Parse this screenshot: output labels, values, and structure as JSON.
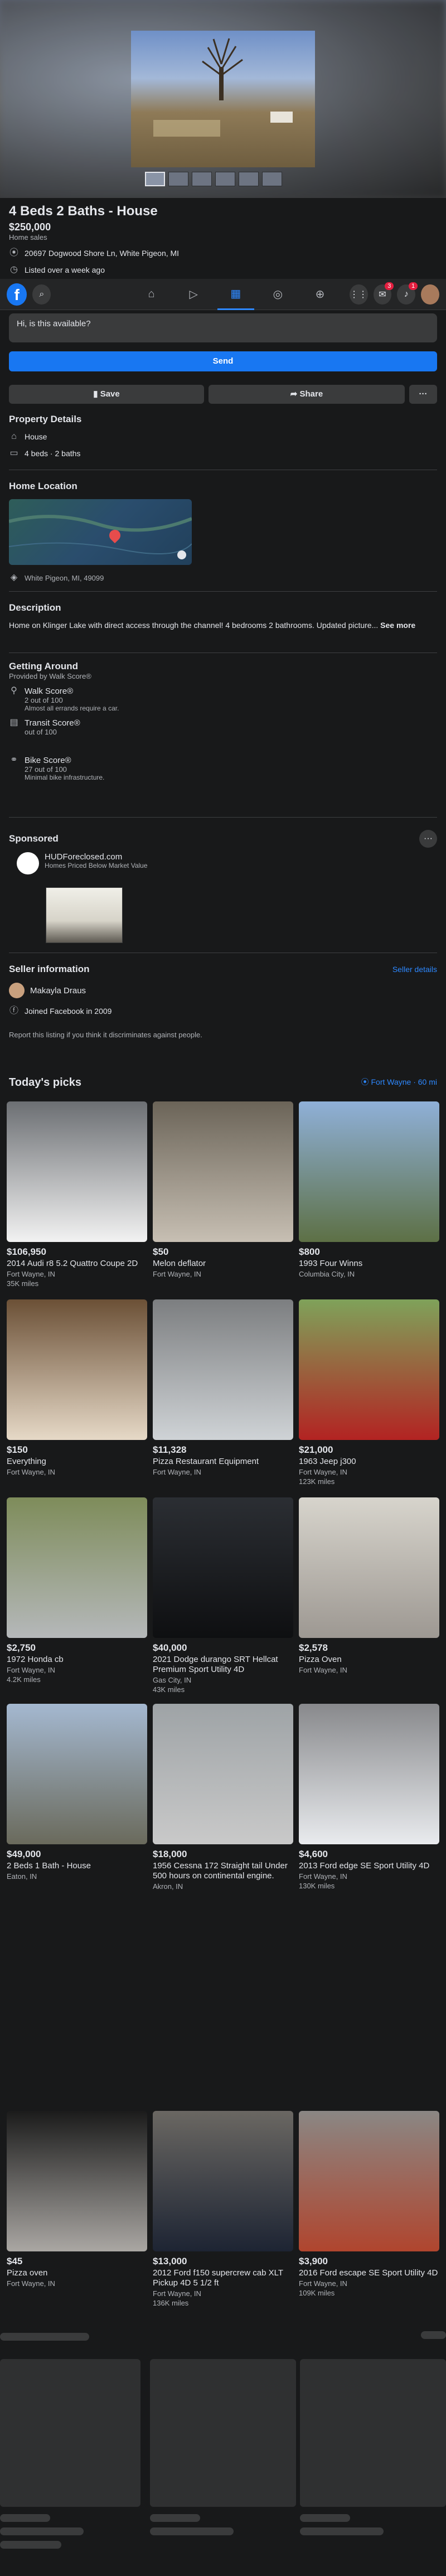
{
  "listing": {
    "title": "4 Beds 2 Baths - House",
    "price": "$250,000",
    "category": "Home sales",
    "address": "20697 Dogwood Shore Ln, White Pigeon, MI",
    "listed": "Listed over a week ago"
  },
  "message": {
    "text": "Hi, is this available?",
    "send_label": "Send"
  },
  "actions": {
    "save": "Save",
    "share": "Share",
    "more": "···"
  },
  "details": {
    "heading": "Property Details",
    "type": "House",
    "rooms": "4 beds · 2 baths"
  },
  "location": {
    "heading": "Home Location",
    "place": "White Pigeon, MI, 49099"
  },
  "description": {
    "heading": "Description",
    "text": "Home on Klinger Lake with direct access through the channel! 4 bedrooms 2 bathrooms. Updated picture...",
    "see_more": "See more"
  },
  "getting_around": {
    "heading": "Getting Around",
    "provider": "Provided by Walk Score®",
    "walk": {
      "label": "Walk Score®",
      "score": "2 out of 100",
      "desc": "Almost all errands require a car."
    },
    "transit": {
      "label": "Transit Score®",
      "score": "out of 100"
    },
    "bike": {
      "label": "Bike Score®",
      "score": "27 out of 100",
      "desc": "Minimal bike infrastructure."
    }
  },
  "sponsored": {
    "heading": "Sponsored",
    "name": "HUDForeclosed.com",
    "tagline": "Homes Priced Below Market Value"
  },
  "seller": {
    "heading": "Seller information",
    "details_link": "Seller details",
    "name": "Makayla Draus",
    "joined": "Joined Facebook in 2009",
    "report": "Report this listing if you think it discriminates against people."
  },
  "picks": {
    "heading": "Today's picks",
    "location": "Fort Wayne · 60 mi",
    "items": [
      {
        "price": "$106,950",
        "title": "2014 Audi r8 5.2 Quattro Coupe 2D",
        "loc": "Fort Wayne, IN",
        "extra": "35K miles"
      },
      {
        "price": "$50",
        "title": "Melon deflator",
        "loc": "Fort Wayne, IN",
        "extra": ""
      },
      {
        "price": "$800",
        "title": "1993 Four Winns",
        "loc": "Columbia City, IN",
        "extra": ""
      },
      {
        "price": "$150",
        "title": "Everything",
        "loc": "Fort Wayne, IN",
        "extra": ""
      },
      {
        "price": "$11,328",
        "title": "Pizza Restaurant Equipment",
        "loc": "Fort Wayne, IN",
        "extra": ""
      },
      {
        "price": "$21,000",
        "title": "1963 Jeep j300",
        "loc": "Fort Wayne, IN",
        "extra": "123K miles"
      },
      {
        "price": "$2,750",
        "title": "1972 Honda cb",
        "loc": "Fort Wayne, IN",
        "extra": "4.2K miles"
      },
      {
        "price": "$40,000",
        "title": "2021 Dodge durango SRT Hellcat Premium Sport Utility 4D",
        "loc": "Gas City, IN",
        "extra": "43K miles"
      },
      {
        "price": "$2,578",
        "title": "Pizza Oven",
        "loc": "Fort Wayne, IN",
        "extra": ""
      },
      {
        "price": "$49,000",
        "title": "2 Beds 1 Bath - House",
        "loc": "Eaton, IN",
        "extra": ""
      },
      {
        "price": "$18,000",
        "title": "1956 Cessna 172 Straight tail Under 500 hours on continental engine.",
        "loc": "Akron, IN",
        "extra": ""
      },
      {
        "price": "$4,600",
        "title": "2013 Ford edge SE Sport Utility 4D",
        "loc": "Fort Wayne, IN",
        "extra": "130K miles"
      },
      {
        "price": "$45",
        "title": "Pizza oven",
        "loc": "Fort Wayne, IN",
        "extra": ""
      },
      {
        "price": "$13,000",
        "title": "2012 Ford f150 supercrew cab XLT Pickup 4D 5 1/2 ft",
        "loc": "Fort Wayne, IN",
        "extra": "136K miles"
      },
      {
        "price": "$3,900",
        "title": "2016 Ford escape SE Sport Utility 4D",
        "loc": "Fort Wayne, IN",
        "extra": "109K miles"
      }
    ]
  },
  "nav": {
    "badge_messenger": "3",
    "badge_notifications": "1"
  }
}
